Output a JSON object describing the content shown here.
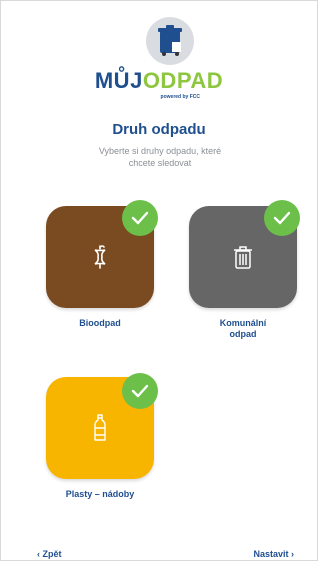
{
  "brand": {
    "name_part1": "MŮJ",
    "name_part2": "ODPAD",
    "powered_by": "powered by FCC",
    "logo_icon": "trash-bin-icon"
  },
  "header": {
    "title": "Druh odpadu",
    "subtitle": "Vyberte si druhy odpadu, které chcete sledovat"
  },
  "categories": [
    {
      "label": "Bioodpad",
      "icon": "apple-core-icon",
      "color": "#7a4a21",
      "selected": true
    },
    {
      "label_line1": "Komunální",
      "label_line2": "odpad",
      "icon": "trash-bin-icon",
      "color": "#666666",
      "selected": true
    },
    {
      "label": "Plasty – nádoby",
      "icon": "plastic-bottle-icon",
      "color": "#f7b500",
      "selected": true
    }
  ],
  "footer": {
    "back_label": "‹ Zpět",
    "next_label": "Nastavit ›"
  },
  "colors": {
    "brand_blue": "#1f4f8f",
    "accent_green": "#6cc04a"
  }
}
